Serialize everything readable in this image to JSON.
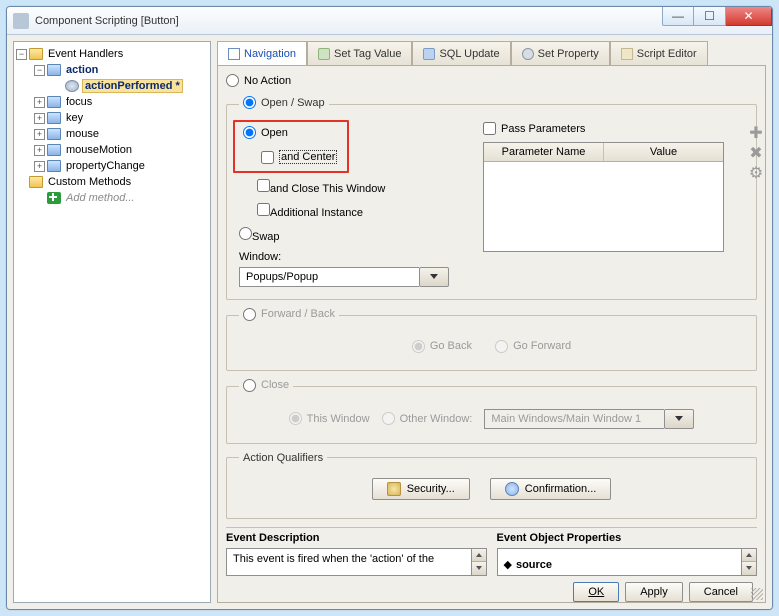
{
  "window": {
    "title": "Component Scripting [Button]"
  },
  "tree": {
    "root": "Event Handlers",
    "action": "action",
    "actionPerformed": "actionPerformed *",
    "focus": "focus",
    "key": "key",
    "mouse": "mouse",
    "mouseMotion": "mouseMotion",
    "propertyChange": "propertyChange",
    "customMethods": "Custom Methods",
    "addMethod": "Add method..."
  },
  "tabs": {
    "navigation": "Navigation",
    "setTag": "Set Tag Value",
    "sql": "SQL Update",
    "setProp": "Set Property",
    "script": "Script Editor"
  },
  "nav": {
    "noAction": "No Action",
    "openSwap": "Open / Swap",
    "open": "Open",
    "andCenter": "and Center",
    "andClose": "and Close This Window",
    "additional": "Additional Instance",
    "swap": "Swap",
    "windowLabel": "Window:",
    "windowValue": "Popups/Popup",
    "passParams": "Pass Parameters",
    "paramName": "Parameter Name",
    "paramValue": "Value",
    "forwardBack": "Forward / Back",
    "goBack": "Go Back",
    "goForward": "Go Forward",
    "close": "Close",
    "thisWindow": "This Window",
    "otherWindow": "Other Window:",
    "otherWindowValue": "Main Windows/Main Window 1",
    "actionQualifiers": "Action Qualifiers",
    "security": "Security...",
    "confirmation": "Confirmation..."
  },
  "desc": {
    "eventDescLabel": "Event Description",
    "eventDescText": "This event is fired when the 'action' of the",
    "eventObjLabel": "Event Object Properties",
    "eventObjHint": "source"
  },
  "footer": {
    "ok": "OK",
    "apply": "Apply",
    "cancel": "Cancel"
  }
}
